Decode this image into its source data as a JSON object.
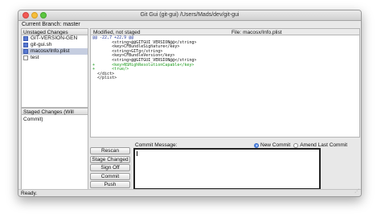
{
  "window": {
    "title": "Git Gui (git-gui) /Users/Mads/dev/git-gui"
  },
  "branch": {
    "label": "Current Branch: master"
  },
  "unstaged": {
    "header": "Unstaged Changes",
    "files": [
      {
        "name": "GIT-VERSION-GEN",
        "icon": "modified-file-icon"
      },
      {
        "name": "git-gui.sh",
        "icon": "modified-file-icon"
      },
      {
        "name": "macosx/Info.plist",
        "icon": "modified-file-icon",
        "selected": true
      },
      {
        "name": "test",
        "icon": "new-file-icon"
      }
    ]
  },
  "staged": {
    "header": "Staged Changes (Will Commit)"
  },
  "diff": {
    "status": "Modified, not staged",
    "file_label": "File:",
    "file": "macosx/Info.plist",
    "lines": [
      {
        "type": "hunk",
        "text": "@@ -22,7 +22,9 @@"
      },
      {
        "type": "ctx",
        "text": "        <string>@@GITGUI_VERSION@@</string>"
      },
      {
        "type": "ctx",
        "text": "        <key>CFBundleSignature</key>"
      },
      {
        "type": "ctx",
        "text": "        <string>GITg</string>"
      },
      {
        "type": "ctx",
        "text": "        <key>CFBundleVersion</key>"
      },
      {
        "type": "ctx",
        "text": "        <string>@@GITGUI_VERSION@@</string>"
      },
      {
        "type": "add",
        "text": "+       <key>NSHighResolutionCapable</key>"
      },
      {
        "type": "add",
        "text": "+       <true/>"
      },
      {
        "type": "ctx",
        "text": "  </dict>"
      },
      {
        "type": "ctx",
        "text": "  </plist>"
      }
    ]
  },
  "commit": {
    "message_label": "Commit Message:",
    "new_commit": "New Commit",
    "amend": "Amend Last Commit",
    "buttons": {
      "rescan": "Rescan",
      "stage_changed": "Stage Changed",
      "sign_off": "Sign Off",
      "commit": "Commit",
      "push": "Push"
    }
  },
  "status": {
    "text": "Ready."
  },
  "colors": {
    "selected_row": "#c5cde0",
    "added_line": "#1b9a1b",
    "hunk_line": "#2a3f9e",
    "modified_icon": "#5a7bd2"
  }
}
